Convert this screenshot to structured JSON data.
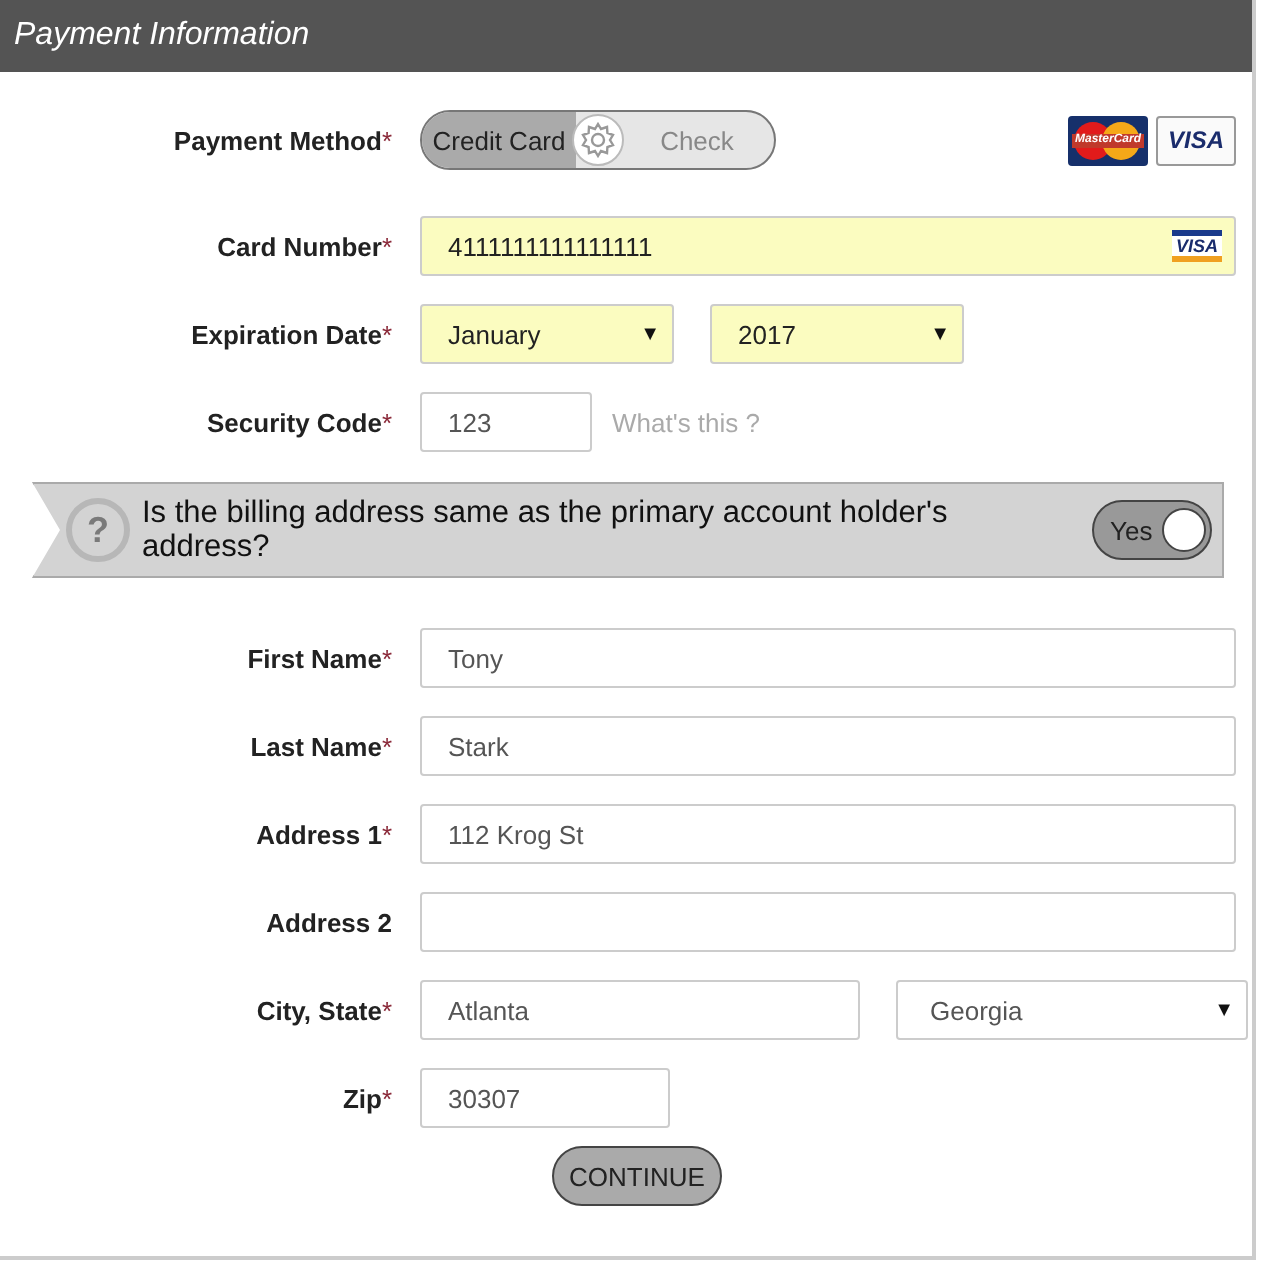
{
  "header": {
    "title": "Payment Information"
  },
  "payment_method": {
    "label": "Payment Method",
    "mark": "*",
    "options": [
      {
        "label": "Credit Card",
        "selected": true
      },
      {
        "label": "Check",
        "selected": false
      }
    ],
    "card_logos": [
      {
        "kind": "mastercard",
        "text": "MasterCard"
      },
      {
        "kind": "visa",
        "text": "VISA"
      }
    ]
  },
  "card_fields": [
    {
      "kind": "text",
      "label": "Card Number",
      "mark": "*",
      "value": "4111111111111111",
      "highlight": true,
      "badge": "VISA"
    },
    {
      "kind": "selects",
      "label": "Expiration Date",
      "mark": "*",
      "selects": [
        {
          "value": "January",
          "arrow": "▼"
        },
        {
          "value": "2017",
          "arrow": "▼"
        }
      ],
      "highlight": true
    },
    {
      "kind": "short",
      "label": "Security Code",
      "mark": "*",
      "value": "123",
      "hint": "What's this ?"
    }
  ],
  "billing_banner": {
    "icon": "?",
    "question": "Is the billing address same as the primary account holder's address?",
    "toggle": {
      "label": "Yes",
      "on": true
    }
  },
  "address_fields": [
    {
      "kind": "text",
      "label": "First Name",
      "mark": "*",
      "value": "Tony"
    },
    {
      "kind": "text",
      "label": "Last Name",
      "mark": "*",
      "value": "Stark"
    },
    {
      "kind": "text",
      "label": "Address 1",
      "mark": "*",
      "value": "112 Krog St"
    },
    {
      "kind": "text",
      "label": "Address 2"
    },
    {
      "kind": "city",
      "label": "City, State",
      "mark": "*",
      "value": "Atlanta",
      "select": {
        "value": "Georgia",
        "arrow": "▼"
      }
    },
    {
      "kind": "short",
      "label": "Zip",
      "mark": "*",
      "value": "30307"
    }
  ],
  "continue_button": "CONTINUE"
}
